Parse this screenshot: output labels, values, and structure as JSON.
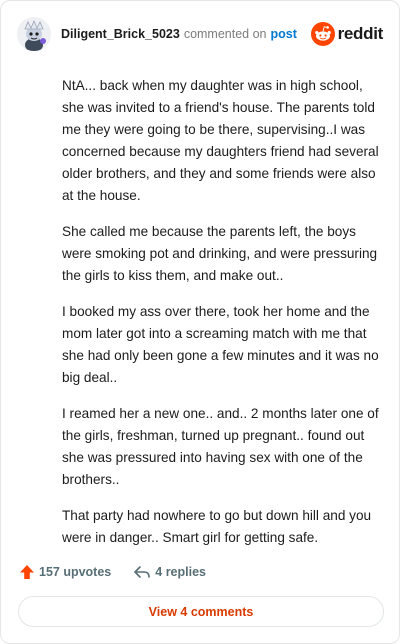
{
  "header": {
    "username": "Diligent_Brick_5023",
    "verb": "commented on",
    "post_link": "post",
    "brand": "reddit"
  },
  "comment": {
    "paragraphs": [
      "NtA... back when my daughter was in high school, she was invited to a friend's house. The parents told me they were going to be there, supervising..I was concerned because my daughters friend had several older brothers, and they and some friends were also at the house.",
      "She called me because the parents left, the boys were smoking pot and drinking, and were pressuring the girls to kiss them, and make out..",
      "I booked my ass over there, took her home and the mom later got into a screaming match with me that she had only been gone a few minutes and it was no big deal..",
      "I reamed her a new one.. and.. 2 months later one of the girls, freshman, turned up pregnant.. found out she was pressured into having sex with one of the brothers..",
      "That party had nowhere to go but down hill and you were in danger.. Smart girl for getting safe."
    ]
  },
  "footer": {
    "upvotes": "157 upvotes",
    "replies": "4 replies",
    "view_comments": "View 4 comments"
  },
  "colors": {
    "reddit_orange": "#ff4500",
    "link_blue": "#0079d3",
    "view_text": "#d93a00"
  },
  "icons": {
    "avatar": "snoo-avatar-icon",
    "brand": "reddit-logo-icon",
    "upvote": "upvote-arrow-icon",
    "reply": "reply-arrow-icon"
  }
}
